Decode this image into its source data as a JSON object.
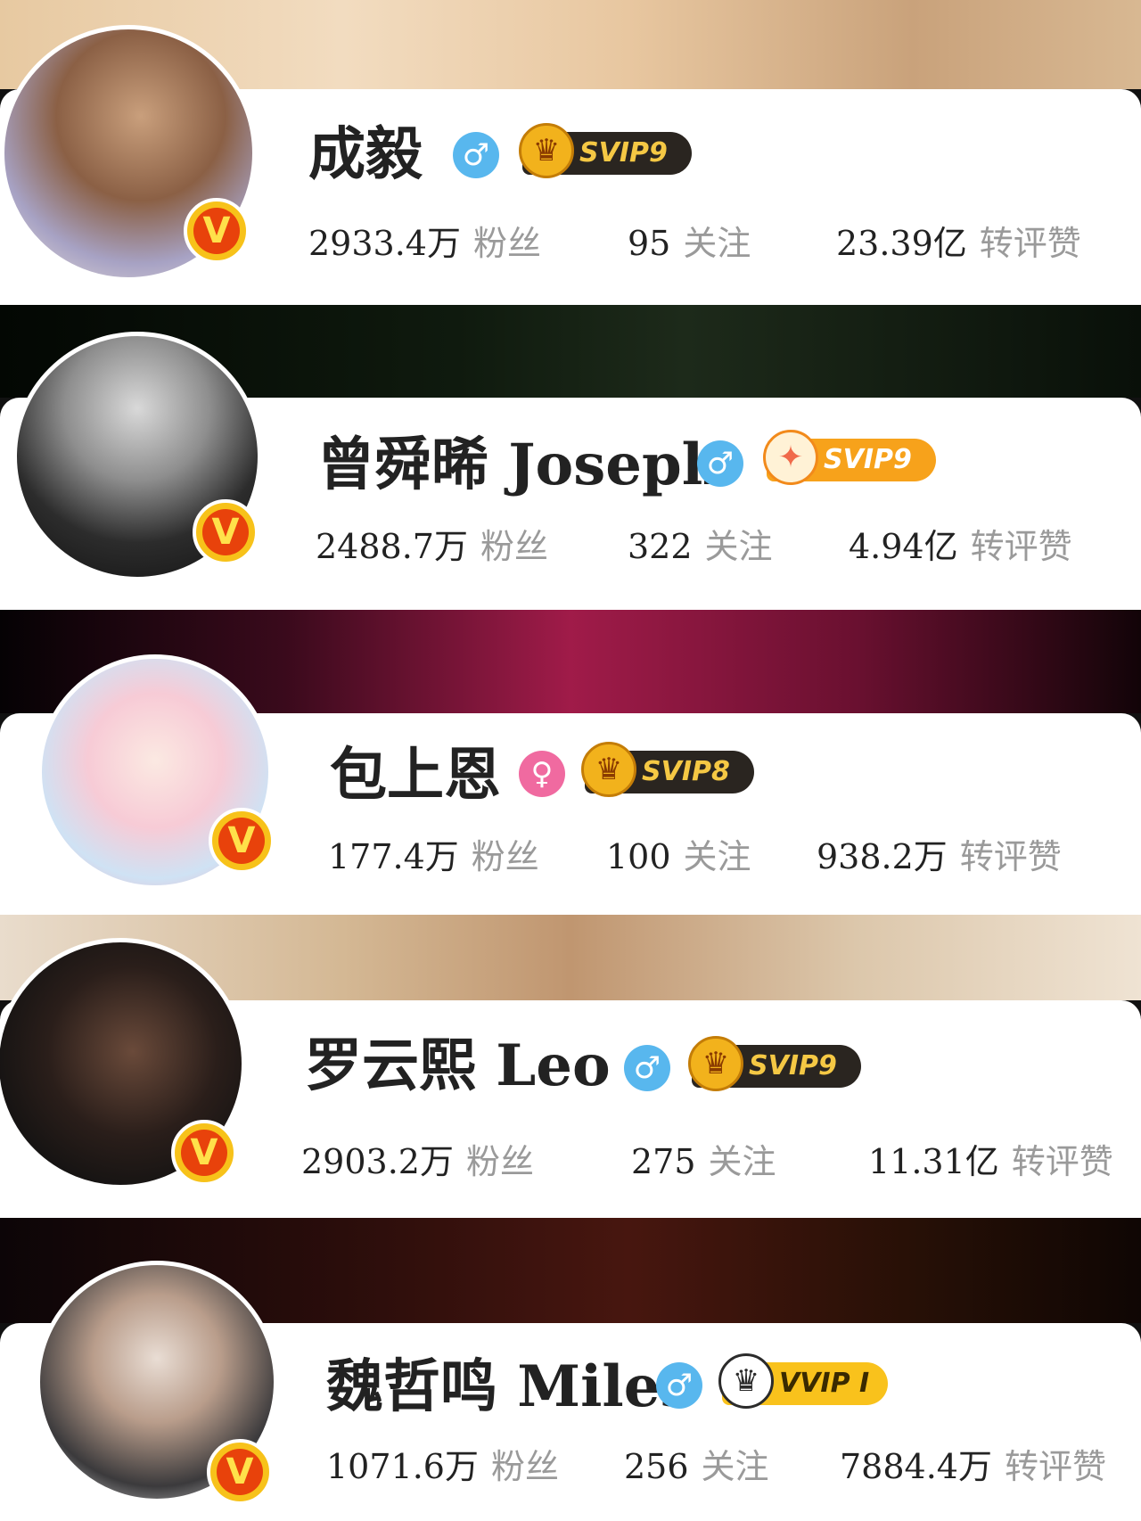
{
  "profiles": [
    {
      "name": "成毅",
      "gender": "♂",
      "vip": "SVIP9",
      "verified": "V",
      "stats": [
        {
          "value": "2933.4万",
          "label": "粉丝"
        },
        {
          "value": "95",
          "label": "关注"
        },
        {
          "value": "23.39亿",
          "label": "转评赞"
        }
      ]
    },
    {
      "name": "曾舜晞 Joseph",
      "gender": "♂",
      "vip": "SVIP9",
      "verified": "V",
      "stats": [
        {
          "value": "2488.7万",
          "label": "粉丝"
        },
        {
          "value": "322",
          "label": "关注"
        },
        {
          "value": "4.94亿",
          "label": "转评赞"
        }
      ]
    },
    {
      "name": "包上恩",
      "gender": "♀",
      "vip": "SVIP8",
      "verified": "V",
      "stats": [
        {
          "value": "177.4万",
          "label": "粉丝"
        },
        {
          "value": "100",
          "label": "关注"
        },
        {
          "value": "938.2万",
          "label": "转评赞"
        }
      ]
    },
    {
      "name": "罗云熙 Leo",
      "gender": "♂",
      "vip": "SVIP9",
      "verified": "V",
      "stats": [
        {
          "value": "2903.2万",
          "label": "粉丝"
        },
        {
          "value": "275",
          "label": "关注"
        },
        {
          "value": "11.31亿",
          "label": "转评赞"
        }
      ]
    },
    {
      "name": "魏哲鸣 Miles",
      "gender": "♂",
      "vip": "VVIP I",
      "verified": "V",
      "stats": [
        {
          "value": "1071.6万",
          "label": "粉丝"
        },
        {
          "value": "256",
          "label": "关注"
        },
        {
          "value": "7884.4万",
          "label": "转评赞"
        }
      ]
    }
  ],
  "icons": {
    "vip_crown": "crown-icon",
    "verified": "verified-badge-icon",
    "male": "male-icon",
    "female": "female-icon"
  },
  "colors": {
    "male": "#58b7ee",
    "female": "#f06aa0",
    "vip_gold": "#f5c844",
    "verified_red": "#e8420b",
    "verified_yellow": "#f7c21a",
    "label_gray": "#9a9a9a"
  }
}
